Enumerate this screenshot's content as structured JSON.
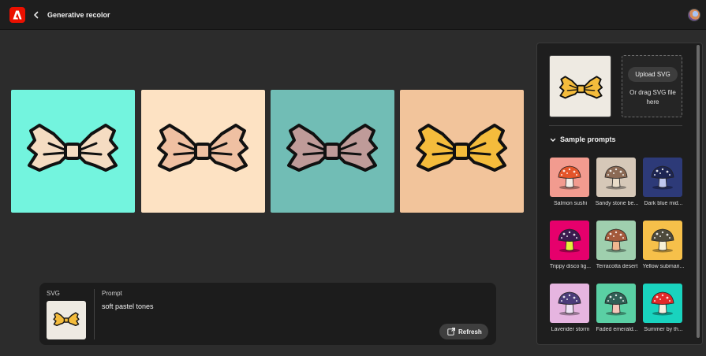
{
  "app": {
    "title": "Generative recolor"
  },
  "colors": {
    "accent": "#eb1000"
  },
  "variations": [
    {
      "bg": "#73f4de",
      "fill": "#f5dcc2"
    },
    {
      "bg": "#fde2c3",
      "fill": "#efc0a2"
    },
    {
      "bg": "#71bdb5",
      "fill": "#bf9b99"
    },
    {
      "bg": "#f2c49b",
      "fill": "#f4bc3c"
    }
  ],
  "prompt_panel": {
    "svg_label": "SVG",
    "prompt_label": "Prompt",
    "prompt_text": "soft pastel tones",
    "refresh_label": "Refresh"
  },
  "side_panel": {
    "upload_label": "Upload SVG",
    "drag_text": "Or drag SVG file here",
    "section_title": "Sample prompts",
    "prompts": [
      {
        "label": "Salmon sushi",
        "bg": "#f29b8f",
        "cap": "#e4552a",
        "stem": "#f4ede6"
      },
      {
        "label": "Sandy stone be...",
        "bg": "#d6c8b8",
        "cap": "#8b6a55",
        "stem": "#e9dcc9"
      },
      {
        "label": "Dark blue mid...",
        "bg": "#2d3a78",
        "cap": "#1d2552",
        "stem": "#bfc7ef"
      },
      {
        "label": "Trippy disco lig...",
        "bg": "#e6006c",
        "cap": "#3b1b4f",
        "stem": "#e3f23a"
      },
      {
        "label": "Terracotta desert",
        "bg": "#9fcfae",
        "cap": "#a45a3c",
        "stem": "#f1b68f"
      },
      {
        "label": "Yellow submari...",
        "bg": "#f6c04a",
        "cap": "#4e4a3c",
        "stem": "#f7f0d6"
      },
      {
        "label": "Lavender storm",
        "bg": "#e6b5e0",
        "cap": "#4b3c79",
        "stem": "#efe4f6"
      },
      {
        "label": "Faded emerald...",
        "bg": "#5ad0a4",
        "cap": "#315f56",
        "stem": "#f6c6b9"
      },
      {
        "label": "Summer by th...",
        "bg": "#19d3be",
        "cap": "#e02a2a",
        "stem": "#f6f0e0"
      }
    ]
  }
}
